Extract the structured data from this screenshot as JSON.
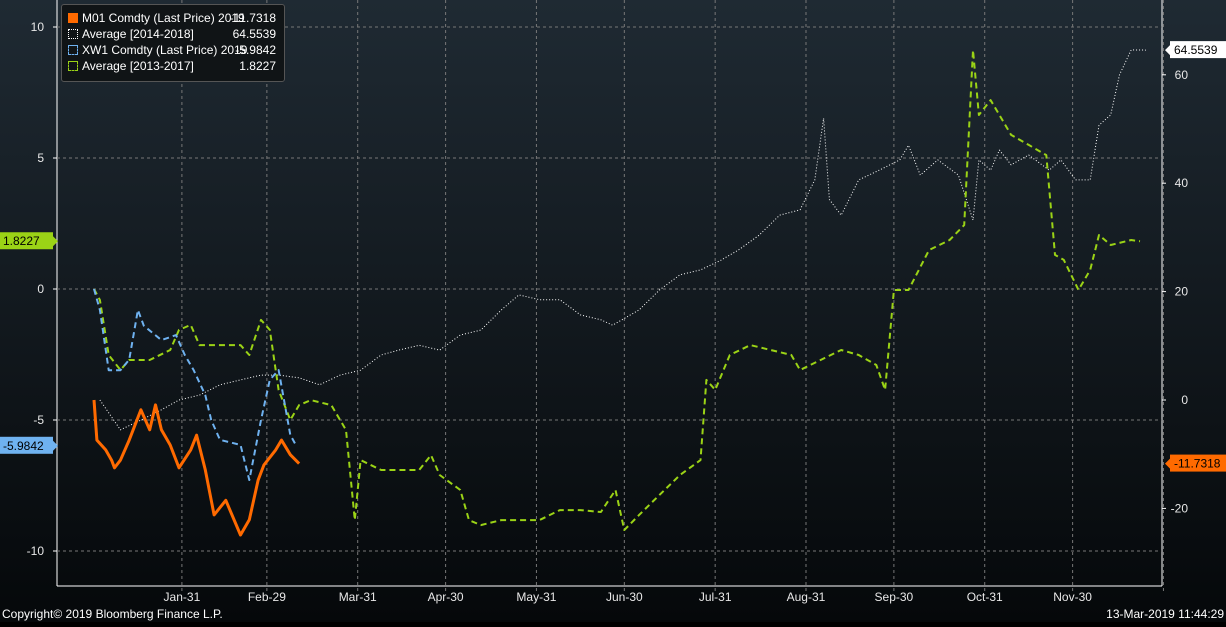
{
  "chart_data": {
    "type": "line",
    "title": "",
    "x_unit": "day of year",
    "x_tick_labels": [
      "Jan-31",
      "Feb-29",
      "Mar-31",
      "Apr-30",
      "May-31",
      "Jun-30",
      "Jul-31",
      "Aug-31",
      "Sep-30",
      "Oct-31",
      "Nov-30"
    ],
    "x_tick_days": [
      30,
      59,
      90,
      120,
      151,
      181,
      212,
      243,
      273,
      304,
      334
    ],
    "xlim": [
      0,
      365
    ],
    "left_axis": {
      "ticks": [
        -10,
        -5,
        0,
        5,
        10
      ],
      "ylim": [
        -11.3,
        11
      ]
    },
    "right_axis": {
      "ticks": [
        -20,
        0,
        20,
        40,
        60
      ],
      "ylim": [
        -34,
        74
      ]
    },
    "grid": true,
    "legend_position": "top-left",
    "series": [
      {
        "name": "M01 Comdty (Last Price) 2019",
        "last": "-11.7318",
        "axis": "right",
        "color": "#ff6a00",
        "style": "solid",
        "x": [
          0,
          1,
          4,
          6,
          7,
          9,
          12,
          16,
          19,
          21,
          23,
          26,
          29,
          33,
          35,
          38,
          41,
          45,
          50,
          53,
          56,
          58,
          62,
          64,
          67,
          70
        ],
        "y": [
          0,
          -7.4,
          -9.2,
          -11.1,
          -12.5,
          -11.1,
          -7.4,
          -1.8,
          -5.5,
          -0.9,
          -5.5,
          -8.3,
          -12.5,
          -9.2,
          -6.5,
          -12.9,
          -21.2,
          -18.5,
          -24.9,
          -22.1,
          -14.8,
          -12,
          -9.2,
          -7.4,
          -10.1,
          -11.73
        ]
      },
      {
        "name": "Average [2014-2018]",
        "last": "64.5539",
        "axis": "right",
        "color": "#ffffff",
        "style": "dotted",
        "x": [
          2,
          9,
          16,
          23,
          29,
          36,
          43,
          50,
          57,
          63,
          70,
          77,
          84,
          91,
          98,
          104,
          111,
          118,
          125,
          132,
          139,
          145,
          152,
          159,
          166,
          173,
          177,
          186,
          193,
          200,
          207,
          214,
          220,
          227,
          234,
          241,
          246,
          249,
          251,
          255,
          261,
          268,
          275,
          278,
          282,
          288,
          295,
          300,
          302,
          306,
          309,
          313,
          319,
          326,
          330,
          335,
          340,
          343,
          347,
          350,
          354,
          359
        ],
        "y": [
          0,
          -5.5,
          -3.7,
          -1.8,
          0,
          0.9,
          2.8,
          3.7,
          4.6,
          4.6,
          4.1,
          2.8,
          4.6,
          5.5,
          8.3,
          9.2,
          10.1,
          9.2,
          12,
          12.9,
          16.6,
          19.4,
          18.5,
          18.5,
          15.7,
          14.8,
          13.8,
          16.6,
          20.3,
          23.1,
          24,
          25.8,
          27.7,
          30.4,
          34.1,
          35.1,
          40.6,
          52,
          37,
          34.1,
          40.6,
          42.4,
          44.3,
          47,
          41.5,
          44.3,
          41.5,
          33.2,
          44.3,
          42.4,
          46.1,
          43.4,
          45.2,
          42.4,
          44.3,
          40.6,
          40.6,
          50.7,
          52.6,
          60,
          64.6,
          64.55
        ]
      },
      {
        "name": "XW1 Comdty (Last Price) 2019",
        "last": "-5.9842",
        "axis": "left",
        "color": "#6fb2f0",
        "style": "dashed",
        "x": [
          0,
          2,
          5,
          9,
          12,
          15,
          17,
          23,
          28,
          31,
          34,
          38,
          40,
          43,
          50,
          53,
          57,
          60,
          63,
          67,
          69
        ],
        "y": [
          0,
          -0.8,
          -3.1,
          -3.1,
          -2.7,
          -0.8,
          -1.4,
          -1.95,
          -1.76,
          -2.52,
          -3.09,
          -4.05,
          -5,
          -5.76,
          -5.95,
          -7.29,
          -5,
          -3.47,
          -3.09,
          -5.57,
          -5.98
        ]
      },
      {
        "name": "Average [2013-2017]",
        "last": "1.8227",
        "axis": "left",
        "color": "#9bd316",
        "style": "dashed",
        "x": [
          0,
          2,
          5,
          9,
          12,
          19,
          26,
          29,
          33,
          36,
          43,
          50,
          53,
          57,
          60,
          63,
          67,
          70,
          74,
          81,
          86,
          89,
          91,
          98,
          104,
          111,
          115,
          118,
          125,
          128,
          132,
          139,
          145,
          152,
          159,
          166,
          173,
          178,
          181,
          186,
          193,
          200,
          207,
          209,
          212,
          217,
          224,
          231,
          238,
          241,
          248,
          255,
          261,
          267,
          270,
          273,
          278,
          285,
          292,
          297,
          300,
          302,
          306,
          309,
          313,
          319,
          325,
          328,
          331,
          336,
          340,
          343,
          347,
          354,
          357
        ],
        "y": [
          0,
          -0.42,
          -2.52,
          -3.09,
          -2.71,
          -2.71,
          -2.33,
          -1.56,
          -1.37,
          -2.14,
          -2.14,
          -2.14,
          -2.52,
          -1.18,
          -1.56,
          -3.85,
          -5,
          -4.43,
          -4.24,
          -4.43,
          -5.38,
          -8.82,
          -6.53,
          -6.91,
          -6.91,
          -6.91,
          -6.34,
          -7.1,
          -7.67,
          -8.82,
          -9.01,
          -8.82,
          -8.82,
          -8.82,
          -8.44,
          -8.44,
          -8.51,
          -7.67,
          -9.2,
          -8.63,
          -7.86,
          -7.1,
          -6.53,
          -3.47,
          -3.85,
          -2.52,
          -2.14,
          -2.33,
          -2.52,
          -3.09,
          -2.71,
          -2.33,
          -2.52,
          -2.9,
          -3.85,
          -0.04,
          -0.04,
          1.49,
          1.87,
          2.44,
          9.12,
          6.64,
          7.21,
          6.64,
          5.88,
          5.5,
          5.11,
          1.3,
          1.11,
          -0.04,
          0.73,
          2.06,
          1.68,
          1.87,
          1.82
        ]
      }
    ]
  },
  "legend": [
    {
      "label": "M01 Comdty (Last Price) 2019",
      "value": "-11.7318"
    },
    {
      "label": "Average [2014-2018]",
      "value": "64.5539"
    },
    {
      "label": "XW1 Comdty (Last Price) 2019",
      "value": "-5.9842"
    },
    {
      "label": "Average [2013-2017]",
      "value": "1.8227"
    }
  ],
  "footer": {
    "copyright": "Copyright© 2019 Bloomberg Finance L.P.",
    "timestamp": "13-Mar-2019 11:44:29"
  }
}
